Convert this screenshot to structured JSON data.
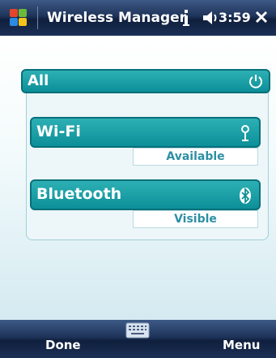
{
  "titlebar": {
    "title": "Wireless Manager",
    "time": "3:59"
  },
  "all": {
    "label": "All"
  },
  "radios": [
    {
      "label": "Wi-Fi",
      "status": "Available",
      "icon": "wifi-antenna-icon"
    },
    {
      "label": "Bluetooth",
      "status": "Visible",
      "icon": "bluetooth-icon"
    }
  ],
  "softkeys": {
    "left": "Done",
    "right": "Menu"
  },
  "colors": {
    "accent": "#0c8f98",
    "status_text": "#2d8fa4",
    "titlebar": "#1e3359"
  }
}
